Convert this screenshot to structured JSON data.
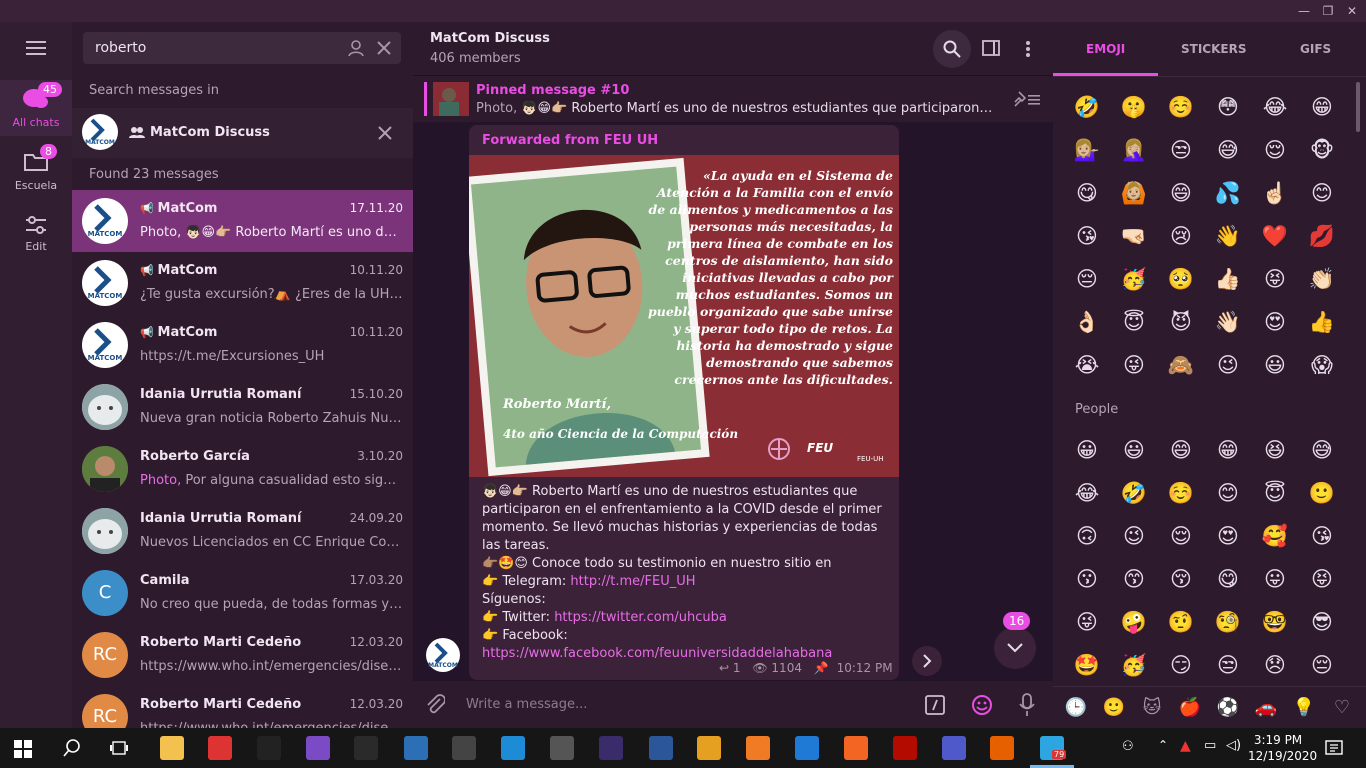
{
  "window": {
    "minimize": "—",
    "maximize": "❐",
    "close": "✕"
  },
  "rail": {
    "all_chats_label": "All chats",
    "all_chats_badge": "45",
    "escuela_label": "Escuela",
    "escuela_badge": "8",
    "edit_label": "Edit"
  },
  "search": {
    "value": "roberto",
    "search_in_label": "Search messages in",
    "scope_chat": "MatCom Discuss",
    "found": "Found 23 messages"
  },
  "results": [
    {
      "name": "MatCom",
      "date": "17.11.20",
      "snippet": "Photo, 👦🏻😁👉🏼 Roberto Martí es uno de nuestros...",
      "avatar": "MATCOM",
      "channel": true
    },
    {
      "name": "MatCom",
      "date": "10.11.20",
      "snippet": "¿Te gusta excursión?⛺ ¿Eres de la UH 🏛️...",
      "avatar": "MATCOM",
      "channel": true
    },
    {
      "name": "MatCom",
      "date": "10.11.20",
      "snippet": "https://t.me/Excursiones_UH",
      "avatar": "MATCOM",
      "channel": true
    },
    {
      "name": "Idania Urrutia Romaní",
      "date": "15.10.20",
      "snippet": "Nueva gran noticia Roberto Zahuis Nuevo ...",
      "avatar": "",
      "channel": false
    },
    {
      "name": "Roberto García",
      "date": "3.10.20",
      "snippet_prefix": "Photo,",
      "snippet": " Por alguna casualidad esto significa...",
      "avatar": "",
      "channel": false
    },
    {
      "name": "Idania Urrutia Romaní",
      "date": "24.09.20",
      "snippet": "Nuevos Licenciados en CC Enrique Cobreir...",
      "avatar": "",
      "channel": false
    },
    {
      "name": "Camila",
      "date": "17.03.20",
      "snippet": "No creo que pueda, de todas formas ya le ...",
      "avatar": "C",
      "channel": false
    },
    {
      "name": "Roberto Marti Cedeño",
      "date": "12.03.20",
      "snippet": "https://www.who.int/emergencies/disease...",
      "avatar": "RC",
      "channel": false
    },
    {
      "name": "Roberto Marti Cedeño",
      "date": "12.03.20",
      "snippet": "https://www.who.int/emergencies/disease...",
      "avatar": "RC",
      "channel": false
    }
  ],
  "chat": {
    "title": "MatCom Discuss",
    "members": "406 members",
    "pinned_title": "Pinned message #10",
    "pinned_text_prefix": "Photo,",
    "pinned_text": " 👦🏻😁👉🏼 Roberto Martí es uno de nuestros estudiantes que participaron en ...",
    "forwarded": "Forwarded from FEU UH",
    "poster": {
      "quote": "«La ayuda en el Sistema de Atención a la Familia con el envío de alimentos y medicamentos a las personas más necesitadas, la primera línea de combate en los centros de aislamiento, han sido iniciativas llevadas a cabo por muchos estudiantes. Somos un pueblo organizado que sabe unirse y superar todo tipo de retos. La historia ha demostrado y sigue demostrando que sabemos crecernos ante las dificultades.",
      "name": "Roberto Martí,",
      "career": "4to año Ciencia de la Computación",
      "logo": "FEU",
      "logo2": "FEU-UH"
    },
    "body": [
      "👦🏻😁👉🏼 Roberto Martí es uno de nuestros estudiantes que participaron en el enfrentamiento a la COVID desde el primer momento. Se llevó muchas historias y experiencias de todas las tareas.",
      "👉🏽🤩😊 Conoce todo su testimonio en nuestro sitio en"
    ],
    "telegram_label": "👉 Telegram: ",
    "telegram_link": "http://t.me/FEU_UH",
    "follow": "Síguenos:",
    "twitter_label": "👉 Twitter: ",
    "twitter_link": "https://twitter.com/uhcuba",
    "facebook_label": "👉 Facebook:",
    "facebook_link": "https://www.facebook.com/feuuniversidaddelahabana",
    "replies": "1",
    "views": "1104",
    "time": "10:12 PM",
    "unread_badge": "16",
    "compose_placeholder": "Write a message..."
  },
  "emoji_panel": {
    "tabs": [
      "EMOJI",
      "STICKERS",
      "GIFS"
    ],
    "recent": [
      "🤣",
      "🤫",
      "☺️",
      "😳",
      "😂",
      "😁",
      "💁🏼‍♀️",
      "🤦🏼‍♀️",
      "😒",
      "😅",
      "😌",
      "🐵",
      "😋",
      "🙆🏼",
      "😄",
      "💦",
      "☝🏻",
      "😊",
      "😘",
      "🤜🏻",
      "😢",
      "👋",
      "❤️",
      "💋",
      "😔",
      "🥳",
      "🥺",
      "👍🏻",
      "😝",
      "👏🏻",
      "👌🏻",
      "😇",
      "😈",
      "👋🏻",
      "😍",
      "👍",
      "😭",
      "😜",
      "🙈",
      "😉",
      "😃",
      "😱"
    ],
    "section_people": "People",
    "people": [
      "😀",
      "😃",
      "😄",
      "😁",
      "😆",
      "😅",
      "😂",
      "🤣",
      "☺️",
      "😊",
      "😇",
      "🙂",
      "🙃",
      "😉",
      "😌",
      "😍",
      "🥰",
      "😘",
      "😗",
      "😙",
      "😚",
      "😋",
      "😛",
      "😝",
      "😜",
      "🤪",
      "🤨",
      "🧐",
      "🤓",
      "😎",
      "🤩",
      "🥳",
      "😏",
      "😒",
      "😞",
      "😔"
    ],
    "categories": [
      "🕒",
      "🙂",
      "🐱",
      "🍎",
      "⚽",
      "🚗",
      "💡",
      "♡"
    ]
  },
  "taskbar": {
    "time": "3:19 PM",
    "date": "12/19/2020",
    "telegram_badge": "79"
  },
  "colors": {
    "accent": "#e94de3",
    "selected": "#7b3479",
    "link": "#e86de6"
  }
}
